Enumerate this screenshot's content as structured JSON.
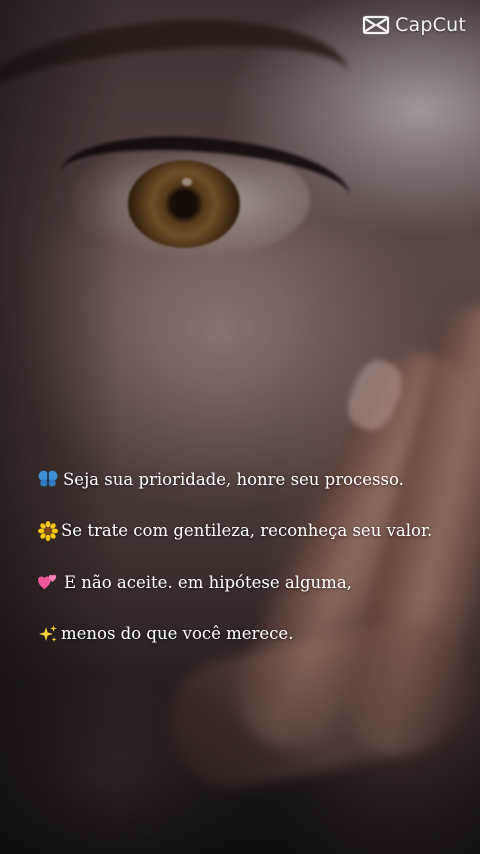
{
  "watermark": {
    "brand": "CapCut",
    "icon": "capcut-logo-icon"
  },
  "quote": {
    "lines": [
      {
        "emoji": "butterfly-icon",
        "text": "Seja sua prioridade, honre seu processo."
      },
      {
        "emoji": "sunflower-icon",
        "text": "Se trate com gentileza, reconheça seu valor."
      },
      {
        "emoji": "two-hearts-icon",
        "text": "E não aceite. em hipótese alguma,"
      },
      {
        "emoji": "sparkles-icon",
        "text": "menos do que você merece."
      }
    ]
  },
  "colors": {
    "text": "#ffffff",
    "butterfly": "#3d8fd6",
    "sunflower_petals": "#f5c518",
    "sunflower_center": "#7a4a12",
    "hearts": "#f0569a",
    "sparkles": "#f7d23a"
  }
}
